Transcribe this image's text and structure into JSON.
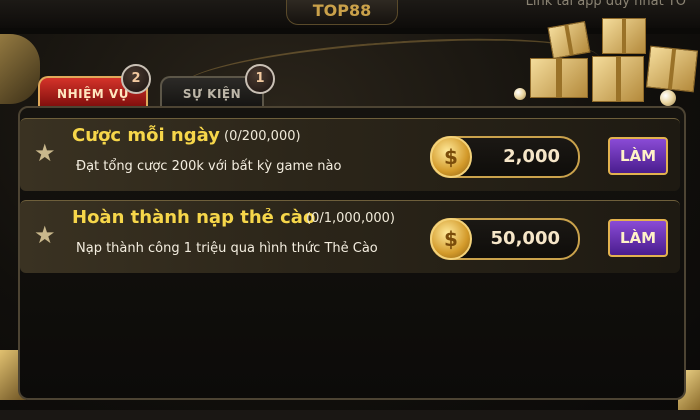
{
  "header": {
    "logo_text": "TOP88",
    "top_link": "Link tải app duy nhất TO"
  },
  "tabs": [
    {
      "label": "NHIỆM VỤ",
      "badge": "2",
      "active": true
    },
    {
      "label": "SỰ KIỆN",
      "badge": "1",
      "active": false
    }
  ],
  "tasks": [
    {
      "title": "Cược mỗi ngày",
      "progress": "(0/200,000)",
      "description": "Đạt tổng cược 200k với bất kỳ game nào",
      "reward": "2,000",
      "button_label": "LÀM"
    },
    {
      "title": "Hoàn thành nạp thẻ cào",
      "progress": "(0/1,000,000)",
      "description": "Nạp thành công 1 triệu qua hình thức Thẻ Cào",
      "reward": "50,000",
      "button_label": "LÀM"
    }
  ],
  "icons": {
    "star": "star-icon",
    "coin": "coin-icon",
    "gift": "gift-boxes-decoration"
  },
  "colors": {
    "accent_gold": "#f6d64a",
    "tab_active": "#d4332a",
    "button_purple": "#8a4bd6"
  }
}
